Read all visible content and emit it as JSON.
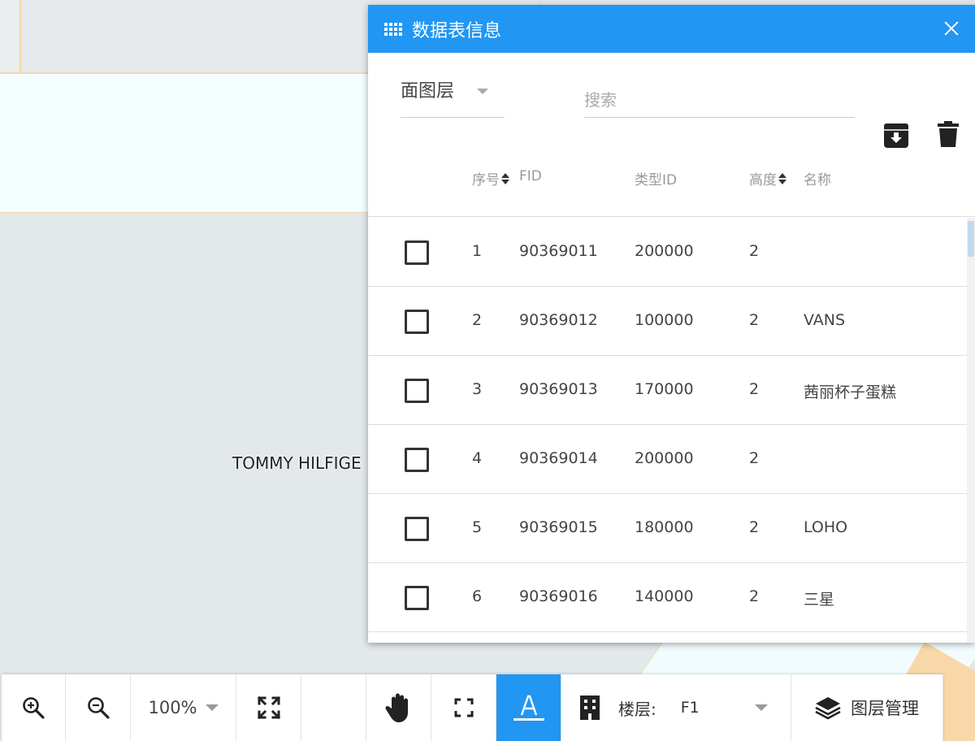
{
  "map": {
    "label": "TOMMY HILFIGE"
  },
  "panel": {
    "title": "数据表信息",
    "layer_select": {
      "value": "面图层"
    },
    "search": {
      "placeholder": "搜索",
      "value": ""
    },
    "icons": {
      "grid": "grid-icon",
      "close": "close-icon",
      "archive": "archive-download-icon",
      "trash": "trash-icon"
    },
    "columns": [
      {
        "label": "序号",
        "sortable": true
      },
      {
        "label": "FID",
        "sortable": false
      },
      {
        "label": "类型ID",
        "sortable": false
      },
      {
        "label": "高度",
        "sortable": true
      },
      {
        "label": "名称",
        "sortable": false
      }
    ],
    "rows": [
      {
        "index": "1",
        "fid": "90369011",
        "type_id": "200000",
        "height": "2",
        "name": ""
      },
      {
        "index": "2",
        "fid": "90369012",
        "type_id": "100000",
        "height": "2",
        "name": "VANS"
      },
      {
        "index": "3",
        "fid": "90369013",
        "type_id": "170000",
        "height": "2",
        "name": "茜丽杯子蛋糕"
      },
      {
        "index": "4",
        "fid": "90369014",
        "type_id": "200000",
        "height": "2",
        "name": ""
      },
      {
        "index": "5",
        "fid": "90369015",
        "type_id": "180000",
        "height": "2",
        "name": "LOHO"
      },
      {
        "index": "6",
        "fid": "90369016",
        "type_id": "140000",
        "height": "2",
        "name": "三星"
      }
    ]
  },
  "toolbar": {
    "zoom_level": "100%",
    "floor_label": "楼层:",
    "floor_value": "F1",
    "layers_label": "图层管理",
    "active_color": "#2196f3",
    "icons": [
      "zoom-in-icon",
      "zoom-out-icon",
      "fullscreen-expand-icon",
      "hand-pan-icon",
      "fit-frame-icon",
      "text-label-icon",
      "building-icon",
      "layers-icon"
    ]
  },
  "colors": {
    "header_blue": "#2196f3",
    "map_bg": "#e3e8ea"
  }
}
